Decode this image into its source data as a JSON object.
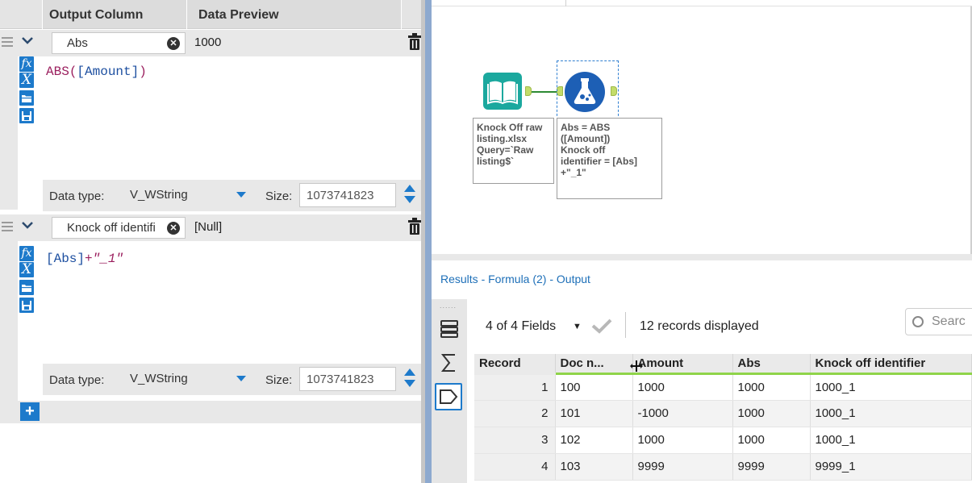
{
  "config": {
    "headers": {
      "output_column": "Output Column",
      "data_preview": "Data Preview"
    },
    "expressions": [
      {
        "name": "Abs",
        "preview": "1000",
        "code_fn": "ABS",
        "code_open": "(",
        "code_field": "[Amount]",
        "code_close": ")",
        "datatype_label": "Data type:",
        "datatype": "V_WString",
        "size_label": "Size:",
        "size": "1073741823"
      },
      {
        "name": "Knock off identifi",
        "preview": "[Null]",
        "code_field": "[Abs]",
        "code_rest": "+\"_1\"",
        "datatype_label": "Data type:",
        "datatype": "V_WString",
        "size_label": "Size:",
        "size": "1073741823"
      }
    ],
    "toolbar_icons": [
      "fx-icon",
      "variable-icon",
      "open-folder-icon",
      "save-icon"
    ]
  },
  "canvas": {
    "input_tool": {
      "icon": "book-icon",
      "annotation": [
        "Knock Off raw",
        "listing.xlsx",
        "Query=`Raw",
        "listing$`"
      ]
    },
    "formula_tool": {
      "icon": "formula-flask-icon",
      "annotation": [
        "Abs = ABS",
        "([Amount])",
        "Knock off",
        "identifier = [Abs]",
        "+\"_1\""
      ]
    },
    "colors": {
      "input": "#1ba89e",
      "formula": "#1d5fb5",
      "connector": "#2d8a34",
      "anchor": "#c3dc6a"
    }
  },
  "results": {
    "title": "Results - Formula (2) - Output",
    "fields_label": "4 of 4 Fields",
    "records_label": "12 records displayed",
    "search_placeholder": "Searc",
    "columns": [
      "Record",
      "Doc n...",
      "Amount",
      "Abs",
      "Knock off identifier"
    ],
    "rows": [
      [
        "1",
        "100",
        "1000",
        "1000",
        "1000_1"
      ],
      [
        "2",
        "101",
        "-1000",
        "1000",
        "1000_1"
      ],
      [
        "3",
        "102",
        "1000",
        "1000",
        "1000_1"
      ],
      [
        "4",
        "103",
        "9999",
        "9999",
        "9999_1"
      ]
    ]
  }
}
